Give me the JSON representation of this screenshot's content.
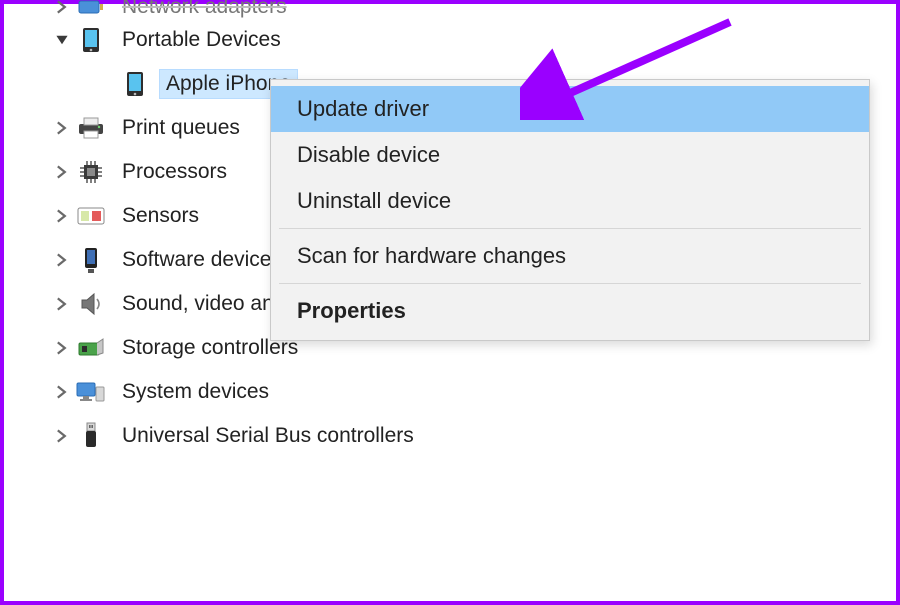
{
  "tree": {
    "cutoff_label": "Network adapters",
    "items": [
      {
        "label": "Portable Devices",
        "expanded": true,
        "children": [
          {
            "label": "Apple iPhone",
            "selected": true
          }
        ]
      },
      {
        "label": "Print queues"
      },
      {
        "label": "Processors"
      },
      {
        "label": "Sensors"
      },
      {
        "label": "Software devices"
      },
      {
        "label": "Sound, video and game controllers"
      },
      {
        "label": "Storage controllers"
      },
      {
        "label": "System devices"
      },
      {
        "label": "Universal Serial Bus controllers"
      }
    ]
  },
  "menu": {
    "items": [
      {
        "label": "Update driver",
        "highlighted": true
      },
      {
        "label": "Disable device"
      },
      {
        "label": "Uninstall device"
      }
    ],
    "scan_label": "Scan for hardware changes",
    "properties_label": "Properties"
  }
}
